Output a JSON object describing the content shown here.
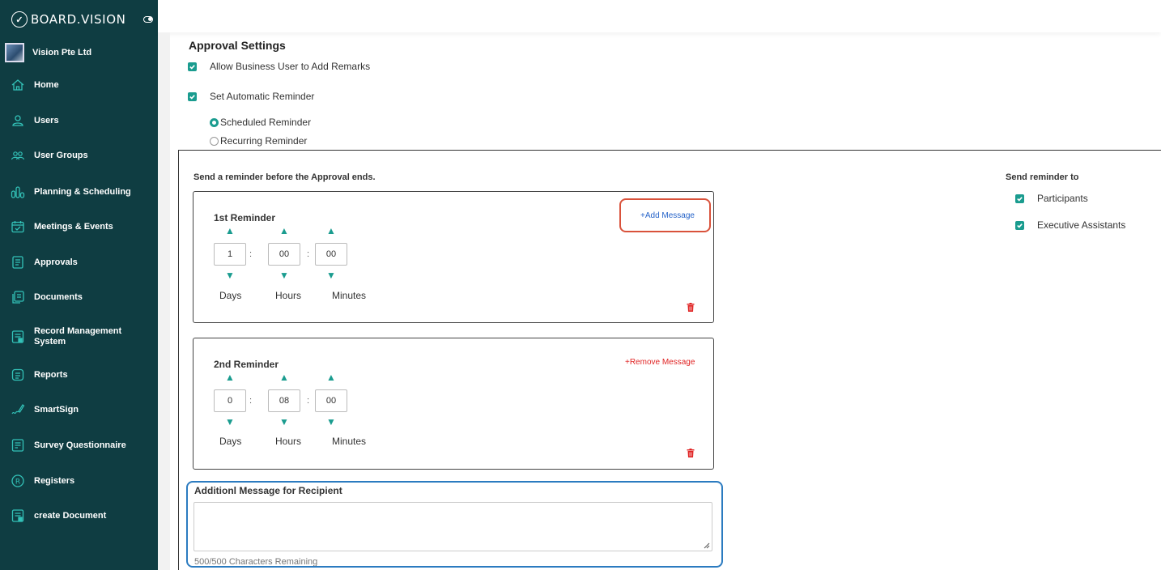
{
  "brand": {
    "name": "BOARD.VISION"
  },
  "company": {
    "name": "Vision Pte Ltd"
  },
  "sidebar": {
    "items": [
      {
        "label": "Home",
        "icon": "home-icon"
      },
      {
        "label": "Users",
        "icon": "user-icon"
      },
      {
        "label": "User Groups",
        "icon": "user-group-icon"
      },
      {
        "label": "Planning & Scheduling",
        "icon": "planning-icon"
      },
      {
        "label": "Meetings & Events",
        "icon": "calendar-icon"
      },
      {
        "label": "Approvals",
        "icon": "approvals-icon"
      },
      {
        "label": "Documents",
        "icon": "documents-icon"
      },
      {
        "label": "Record Management System",
        "icon": "record-icon"
      },
      {
        "label": "Reports",
        "icon": "reports-icon"
      },
      {
        "label": "SmartSign",
        "icon": "signature-icon"
      },
      {
        "label": "Survey Questionnaire",
        "icon": "survey-icon"
      },
      {
        "label": "Registers",
        "icon": "registered-icon"
      },
      {
        "label": "create Document",
        "icon": "create-document-icon"
      }
    ]
  },
  "main": {
    "title": "Approval Settings",
    "allow_remarks": {
      "label": "Allow Business User to Add Remarks",
      "checked": true
    },
    "auto_reminder": {
      "label": "Set Automatic Reminder",
      "checked": true
    },
    "reminder_types": [
      {
        "label": "Scheduled Reminder",
        "selected": true
      },
      {
        "label": "Recurring Reminder",
        "selected": false
      }
    ],
    "send_before_label": "Send a reminder before the Approval ends.",
    "send_to": {
      "label": "Send reminder to",
      "options": [
        {
          "label": "Participants",
          "checked": true
        },
        {
          "label": "Executive Assistants",
          "checked": true
        }
      ]
    },
    "reminders": [
      {
        "title": "1st Reminder",
        "link": "+Add Message",
        "days": "1",
        "hours": "00",
        "minutes": "00"
      },
      {
        "title": "2nd Reminder",
        "link": "+Remove Message",
        "days": "0",
        "hours": "08",
        "minutes": "00"
      }
    ],
    "units": {
      "days": "Days",
      "hours": "Hours",
      "minutes": "Minutes"
    },
    "message": {
      "label": "Additionl Message for Recipient",
      "value": "",
      "chars_remaining": "500/500 Characters Remaining"
    }
  },
  "colors": {
    "sidebar_bg": "#0f3d42",
    "accent": "#1a9c8f",
    "link_blue": "#2563c9",
    "link_red": "#e02424"
  }
}
